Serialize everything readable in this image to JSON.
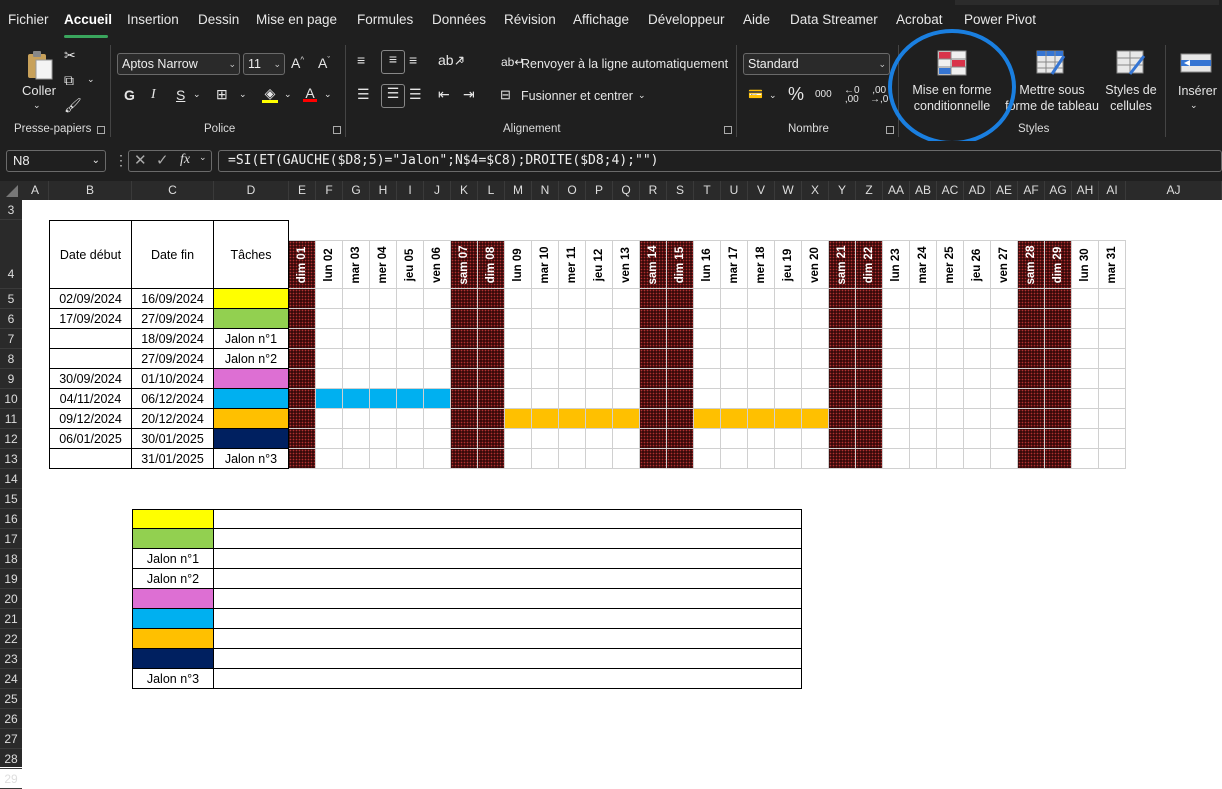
{
  "tabs": [
    "Fichier",
    "Accueil",
    "Insertion",
    "Dessin",
    "Mise en page",
    "Formules",
    "Données",
    "Révision",
    "Affichage",
    "Développeur",
    "Aide",
    "Data Streamer",
    "Acrobat",
    "Power Pivot"
  ],
  "active_tab": "Accueil",
  "ribbon": {
    "clipboard": {
      "paste": "Coller",
      "label": "Presse-papiers"
    },
    "font": {
      "name": "Aptos Narrow",
      "size": "11",
      "bold": "G",
      "italic": "I",
      "underline": "S",
      "label": "Police"
    },
    "alignment": {
      "wrap": "Renvoyer à la ligne automatiquement",
      "merge": "Fusionner et centrer",
      "label": "Alignement"
    },
    "number": {
      "format": "Standard",
      "percent": "%",
      "thousands": "000",
      "label": "Nombre"
    },
    "styles": {
      "conditional": "Mise en forme conditionnelle",
      "table": "Mettre sous forme de tableau",
      "cell_styles": "Styles de cellules",
      "label": "Styles"
    },
    "cells": {
      "insert": "Insérer"
    }
  },
  "name_box": "N8",
  "fx": "fx",
  "formula": "=SI(ET(GAUCHE($D8;5)=\"Jalon\";N$4=$C8);DROITE($D8;4);\"\")",
  "columns": [
    "A",
    "B",
    "C",
    "D",
    "E",
    "F",
    "G",
    "H",
    "I",
    "J",
    "K",
    "L",
    "M",
    "N",
    "O",
    "P",
    "Q",
    "R",
    "S",
    "T",
    "U",
    "V",
    "W",
    "X",
    "Y",
    "Z",
    "AA",
    "AB",
    "AC",
    "AD",
    "AE",
    "AF",
    "AG",
    "AH",
    "AI",
    "AJ"
  ],
  "rows": [
    "3",
    "4",
    "5",
    "6",
    "7",
    "8",
    "9",
    "10",
    "11",
    "12",
    "13",
    "14",
    "15",
    "16",
    "17",
    "18",
    "19",
    "20",
    "21",
    "22",
    "23",
    "24",
    "25",
    "26",
    "27",
    "28",
    "29"
  ],
  "headers": {
    "start": "Date début",
    "end": "Date fin",
    "tasks": "Tâches"
  },
  "days": [
    "dim 01",
    "lun 02",
    "mar 03",
    "mer 04",
    "jeu 05",
    "ven 06",
    "sam 07",
    "dim 08",
    "lun 09",
    "mar 10",
    "mer 11",
    "jeu 12",
    "ven 13",
    "sam 14",
    "dim 15",
    "lun 16",
    "mar 17",
    "mer 18",
    "jeu 19",
    "ven 20",
    "sam 21",
    "dim 22",
    "lun 23",
    "mar 24",
    "mer 25",
    "jeu 26",
    "ven 27",
    "sam 28",
    "dim 29",
    "lun 30",
    "mar 31"
  ],
  "weekend_days": [
    0,
    6,
    7,
    13,
    14,
    20,
    21,
    27,
    28
  ],
  "tasks": [
    {
      "start": "02/09/2024",
      "end": "16/09/2024",
      "label": "",
      "color": "#ffff00",
      "bar": []
    },
    {
      "start": "17/09/2024",
      "end": "27/09/2024",
      "label": "",
      "color": "#92d050",
      "bar": []
    },
    {
      "start": "",
      "end": "18/09/2024",
      "label": "Jalon n°1",
      "color": "",
      "bar": []
    },
    {
      "start": "",
      "end": "27/09/2024",
      "label": "Jalon n°2",
      "color": "",
      "bar": []
    },
    {
      "start": "30/09/2024",
      "end": "01/10/2024",
      "label": "",
      "color": "#dd6fd3",
      "bar": []
    },
    {
      "start": "04/11/2024",
      "end": "06/12/2024",
      "label": "",
      "color": "#00b0f0",
      "bar": [
        1,
        2,
        3,
        4,
        5
      ]
    },
    {
      "start": "09/12/2024",
      "end": "20/12/2024",
      "label": "",
      "color": "#ffc000",
      "bar": [
        8,
        9,
        10,
        11,
        12,
        15,
        16,
        17,
        18,
        19
      ]
    },
    {
      "start": "06/01/2025",
      "end": "30/01/2025",
      "label": "",
      "color": "#002060",
      "bar": []
    },
    {
      "start": "",
      "end": "31/01/2025",
      "label": "Jalon n°3",
      "color": "",
      "bar": []
    }
  ],
  "legend": [
    {
      "label": "",
      "color": "#ffff00"
    },
    {
      "label": "",
      "color": "#92d050"
    },
    {
      "label": "Jalon n°1",
      "color": ""
    },
    {
      "label": "Jalon n°2",
      "color": ""
    },
    {
      "label": "",
      "color": "#dd6fd3"
    },
    {
      "label": "",
      "color": "#00b0f0"
    },
    {
      "label": "",
      "color": "#ffc000"
    },
    {
      "label": "",
      "color": "#002060"
    },
    {
      "label": "Jalon n°3",
      "color": ""
    }
  ]
}
